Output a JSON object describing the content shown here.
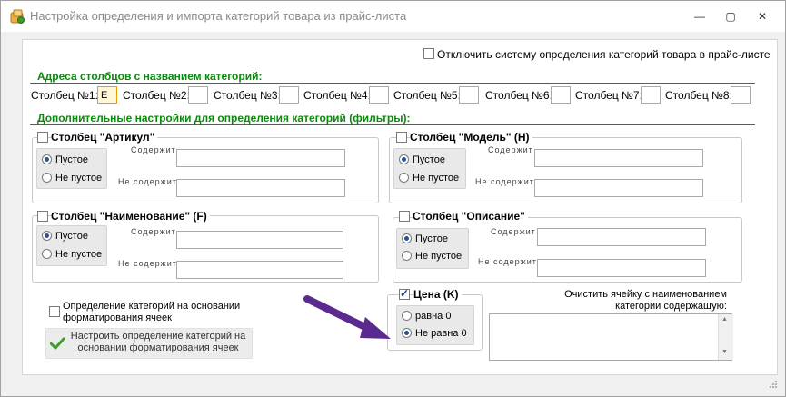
{
  "window": {
    "title": "Настройка определения и импорта категорий товара из прайс-листа",
    "controls": {
      "minimize": "—",
      "restore": "▢",
      "close": "✕"
    }
  },
  "disable_option": {
    "label": "Отключить систему определения категорий товара в прайс-листе",
    "checked": false
  },
  "columns_section": {
    "heading": "Адреса столбцов с названием категорий:",
    "items": [
      {
        "label": "Столбец №1:",
        "value": "E"
      },
      {
        "label": "Столбец №2:",
        "value": ""
      },
      {
        "label": "Столбец №3:",
        "value": ""
      },
      {
        "label": "Столбец №4:",
        "value": ""
      },
      {
        "label": "Столбец №5:",
        "value": ""
      },
      {
        "label": "Столбец №6:",
        "value": ""
      },
      {
        "label": "Столбец №7:",
        "value": ""
      },
      {
        "label": "Столбец №8:",
        "value": ""
      }
    ]
  },
  "filters_section": {
    "heading": "Дополнительные настройки для определения категорий (фильтры):",
    "groups": [
      {
        "title": "Столбец \"Артикул\"",
        "checked": false,
        "radio_empty": "Пустое",
        "radio_not_empty": "Не пустое",
        "selected": "empty",
        "contains_label": "Содержит",
        "not_contains_label": "Не содержит",
        "contains_value": "",
        "not_contains_value": ""
      },
      {
        "title": "Столбец \"Модель\" (H)",
        "checked": false,
        "radio_empty": "Пустое",
        "radio_not_empty": "Не пустое",
        "selected": "empty",
        "contains_label": "Содержит",
        "not_contains_label": "Не содержит",
        "contains_value": "",
        "not_contains_value": ""
      },
      {
        "title": "Столбец \"Наименование\" (F)",
        "checked": false,
        "radio_empty": "Пустое",
        "radio_not_empty": "Не пустое",
        "selected": "empty",
        "contains_label": "Содержит",
        "not_contains_label": "Не содержит",
        "contains_value": "",
        "not_contains_value": ""
      },
      {
        "title": "Столбец \"Описание\"",
        "checked": false,
        "radio_empty": "Пустое",
        "radio_not_empty": "Не пустое",
        "selected": "empty",
        "contains_label": "Содержит",
        "not_contains_label": "Не содержит",
        "contains_value": "",
        "not_contains_value": ""
      }
    ]
  },
  "format_option": {
    "label_line1": "Определение категорий на основании",
    "label_line2": "форматирования ячеек",
    "checked": false
  },
  "configure_button": {
    "line1": "Настроить определение категорий на",
    "line2": "основании форматирования ячеек"
  },
  "price_group": {
    "title": "Цена (K)",
    "checked": true,
    "radio_equal": "равна 0",
    "radio_not_equal": "Не равна 0",
    "selected": "not_equal"
  },
  "clear_cell": {
    "label_line1": "Очистить ячейку с наименованием",
    "label_line2": "категории содержащую:",
    "value": ""
  },
  "colors": {
    "section_heading": "#0a8a0a",
    "annotation_arrow": "#5a2a8e"
  }
}
